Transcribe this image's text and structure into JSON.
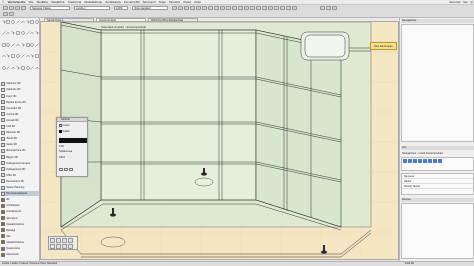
{
  "menubar": {
    "app_name": "Vectorworks",
    "items": [
      "File",
      "Modifica",
      "Visualizza",
      "Trasforma",
      "Modellazione",
      "Architettura",
      "InteriorCAD",
      "Strumenti",
      "Testo",
      "Finestra",
      "Cloud",
      "Aiuto"
    ],
    "right_items": [
      "Zero fax",
      "Gio",
      "Q"
    ]
  },
  "toolbar": {
    "class_field": "Nessuna Classe",
    "layer_field": "Livello-1",
    "zoom_field": "100%",
    "view_field": "Vista standard"
  },
  "tabs": [
    {
      "label": "Senza Titolo 1"
    },
    {
      "label": "Interiorprodukt"
    },
    {
      "label": "2016-03-23Kombihalterlcad"
    }
  ],
  "tool_icons": [
    "arrow-icon",
    "pan-icon",
    "zoom-icon",
    "line-icon",
    "rectangle-icon",
    "circle-icon",
    "arc-icon",
    "polyline-icon",
    "text-icon",
    "dimension-icon",
    "polygon-icon",
    "freehand-icon",
    "wall-icon",
    "door-icon",
    "window-icon",
    "stair-icon",
    "column-icon",
    "slab-icon",
    "roof-icon",
    "light-icon",
    "3d-icon",
    "extrude-icon",
    "sweep-icon",
    "loft-icon",
    "mirror-icon",
    "rotate-icon",
    "offset-icon",
    "trim-icon",
    "fillet-icon",
    "chamfer-icon",
    "symbol-icon",
    "eyedropper-icon",
    "camera-icon",
    "section-icon",
    "grid-icon",
    "measure-icon",
    "tape-icon",
    "hatch-icon",
    "tag-icon",
    "cloud-icon"
  ],
  "leftpanel": {
    "items": [
      {
        "label": "Cabinets 3D",
        "selected": false,
        "dark": false
      },
      {
        "label": "Cabinets 3D",
        "selected": false,
        "dark": false
      },
      {
        "label": "Corpi 3D",
        "selected": false,
        "dark": false
      },
      {
        "label": "Ripiani leccio 3D",
        "selected": false,
        "dark": false
      },
      {
        "label": "Comodini 3D",
        "selected": false,
        "dark": false
      },
      {
        "label": "Cucina 3D",
        "selected": false,
        "dark": false
      },
      {
        "label": "Armadi 3D",
        "selected": false,
        "dark": false
      },
      {
        "label": "Letti 3D",
        "selected": false,
        "dark": false
      },
      {
        "label": "Mensole 3D",
        "selected": false,
        "dark": false
      },
      {
        "label": "Tavoli 3D",
        "selected": false,
        "dark": false
      },
      {
        "label": "Sedie 3D",
        "selected": false,
        "dark": false
      },
      {
        "label": "Illuminazione 3D",
        "selected": false,
        "dark": false
      },
      {
        "label": "Bagno 3D",
        "selected": false,
        "dark": false
      },
      {
        "label": "Collegamenti tempor.",
        "selected": false,
        "dark": false
      },
      {
        "label": "Collegamenti 3D",
        "selected": false,
        "dark": false
      },
      {
        "label": "Uffici 3D",
        "selected": false,
        "dark": false
      },
      {
        "label": "Decorazioni 3D",
        "selected": false,
        "dark": false
      },
      {
        "label": "Space Planning",
        "selected": false,
        "dark": false
      },
      {
        "label": "Dimensionamento",
        "selected": true,
        "dark": false
      },
      {
        "label": "3D",
        "selected": false,
        "dark": true
      },
      {
        "label": "Architettura",
        "selected": false,
        "dark": true
      },
      {
        "label": "Arredamento",
        "selected": false,
        "dark": true
      },
      {
        "label": "Strumenti",
        "selected": false,
        "dark": true
      },
      {
        "label": "Visualizzazione",
        "selected": false,
        "dark": true
      },
      {
        "label": "Dettagli",
        "selected": false,
        "dark": true
      },
      {
        "label": "Sito",
        "selected": false,
        "dark": true
      },
      {
        "label": "Visualizzazione",
        "selected": false,
        "dark": true
      },
      {
        "label": "Costruzione",
        "selected": false,
        "dark": true
      },
      {
        "label": "Interiorcad",
        "selected": false,
        "dark": true
      }
    ]
  },
  "attributes": {
    "title": "Attributi",
    "fill_label": "Colore",
    "pen_label": "Solida",
    "line_weight": "0.05",
    "line_label": "Solida Linea",
    "opacity": "100%"
  },
  "canvas_tab_label": "Standard-Ansicht - Interiorprodukt",
  "save_button": "Esci dal Gruppo",
  "rightpanel": {
    "title1": "Navigazione",
    "title2": "Risorse",
    "title3": "Info",
    "browser_title": "Navigazione - Livelli Interiorprodukt",
    "rows": [
      "Nessuna",
      "Raster",
      "Sfondo Tavola"
    ]
  },
  "statusbar": {
    "text": "Livello: Livello-1  Classe: Nessuna  Vista: Standard",
    "right": "Vista 3D"
  },
  "colors": {
    "canvas_bg": "#f4e6c2",
    "model_fill": "#dce9d3",
    "accent": "#4a7bc8",
    "selected_row": "#bfc9d8"
  }
}
